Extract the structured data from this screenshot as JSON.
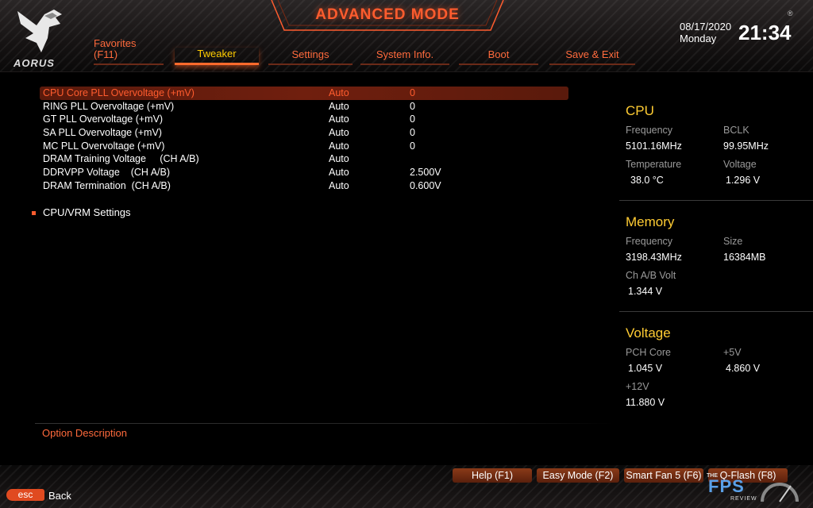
{
  "header": {
    "brand": "AORUS",
    "mode_title": "ADVANCED MODE",
    "date": "08/17/2020",
    "weekday": "Monday",
    "time": "21:34",
    "reg_mark": "®"
  },
  "tabs": [
    {
      "label": "Favorites",
      "sub": "(F11)"
    },
    {
      "label": "Tweaker",
      "active": true
    },
    {
      "label": "Settings"
    },
    {
      "label": "System Info."
    },
    {
      "label": "Boot"
    },
    {
      "label": "Save & Exit"
    }
  ],
  "settings": [
    {
      "label": "CPU Core PLL Overvoltage (+mV)",
      "mode": "Auto",
      "value": "0",
      "selected": true
    },
    {
      "label": "RING PLL Overvoltage (+mV)",
      "mode": "Auto",
      "value": "0"
    },
    {
      "label": "GT PLL Overvoltage (+mV)",
      "mode": "Auto",
      "value": "0"
    },
    {
      "label": "SA PLL Overvoltage (+mV)",
      "mode": "Auto",
      "value": "0"
    },
    {
      "label": "MC PLL Overvoltage (+mV)",
      "mode": "Auto",
      "value": "0"
    },
    {
      "label": "DRAM Training Voltage     (CH A/B)",
      "mode": "Auto",
      "value": ""
    },
    {
      "label": "DDRVPP Voltage    (CH A/B)",
      "mode": "Auto",
      "value": "2.500V"
    },
    {
      "label": "DRAM Termination  (CH A/B)",
      "mode": "Auto",
      "value": "0.600V"
    }
  ],
  "submenu": {
    "label": "CPU/VRM Settings"
  },
  "description": {
    "title": "Option Description"
  },
  "panel": {
    "cpu": {
      "title": "CPU",
      "frequency_label": "Frequency",
      "frequency": "5101.16MHz",
      "bclk_label": "BCLK",
      "bclk": "99.95MHz",
      "temperature_label": "Temperature",
      "temperature": "38.0 °C",
      "voltage_label": "Voltage",
      "voltage": "1.296 V"
    },
    "memory": {
      "title": "Memory",
      "frequency_label": "Frequency",
      "frequency": "3198.43MHz",
      "size_label": "Size",
      "size": "16384MB",
      "chab_label": "Ch A/B Volt",
      "chab": "1.344 V"
    },
    "voltage": {
      "title": "Voltage",
      "pch_label": "PCH Core",
      "pch": "1.045 V",
      "v5_label": "+5V",
      "v5": "4.860 V",
      "v12_label": "+12V",
      "v12": "11.880 V"
    }
  },
  "footer": {
    "buttons": [
      "Help (F1)",
      "Easy Mode (F2)",
      "Smart Fan 5 (F6)",
      "Q-Flash (F8)"
    ],
    "esc": "esc",
    "back": "Back"
  },
  "watermark": {
    "the": "THE",
    "fps": "FPS",
    "review": "REVIEW"
  },
  "colors": {
    "accent": "#ff5c2e",
    "section_title": "#ffcc33",
    "active_tab": "#ffcc00"
  }
}
